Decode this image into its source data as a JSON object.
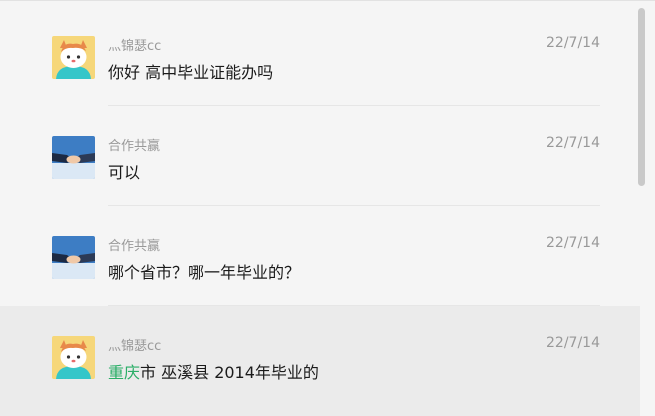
{
  "conversations": [
    {
      "sender": "灬锦瑟cc",
      "time": "22/7/14",
      "message": "你好  高中毕业证能办吗",
      "avatar": "cartoon-cat-avatar-icon"
    },
    {
      "sender": "合作共赢",
      "time": "22/7/14",
      "message": "可以",
      "avatar": "handshake-avatar-icon"
    },
    {
      "sender": "合作共赢",
      "time": "22/7/14",
      "message": "哪个省市？哪一年毕业的？",
      "avatar": "handshake-avatar-icon"
    },
    {
      "sender": "灬锦瑟cc",
      "time": "22/7/14",
      "message_highlight": "重庆",
      "message_rest": "市 巫溪县 2014年毕业的",
      "avatar": "cartoon-cat-avatar-icon",
      "selected": true
    }
  ],
  "colors": {
    "highlight": "#2aae67",
    "selected_bg": "#ebebeb",
    "background": "#f5f5f5"
  }
}
